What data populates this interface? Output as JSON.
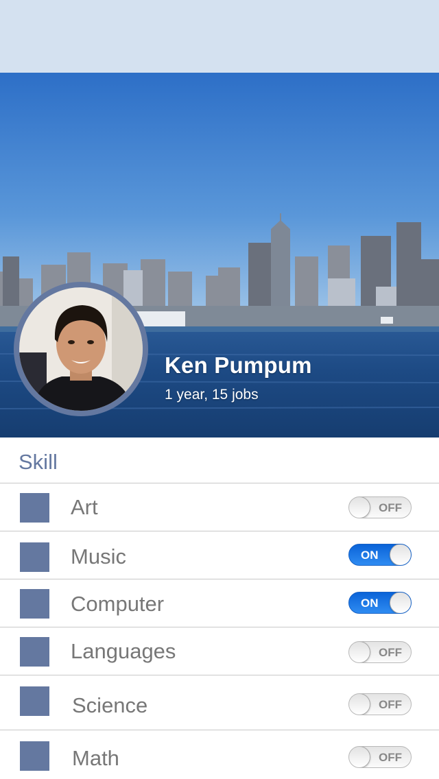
{
  "profile": {
    "name": "Ken Pumpum",
    "subtitle": "1 year, 15 jobs"
  },
  "skills": {
    "header": "Skill",
    "items": [
      {
        "label": "Art",
        "toggle": "OFF"
      },
      {
        "label": "Music",
        "toggle": "ON"
      },
      {
        "label": "Computer",
        "toggle": "ON"
      },
      {
        "label": "Languages",
        "toggle": "OFF"
      },
      {
        "label": "Science",
        "toggle": "OFF"
      },
      {
        "label": "Math",
        "toggle": "OFF"
      }
    ]
  },
  "colors": {
    "top_bar": "#d4e1f0",
    "accent": "#6478a0",
    "toggle_on": "#1a74e6",
    "label_text": "#777777"
  }
}
